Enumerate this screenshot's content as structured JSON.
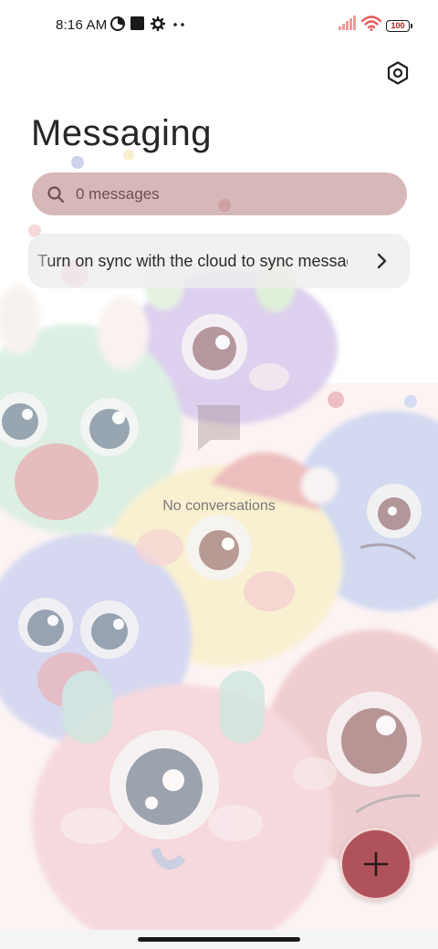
{
  "status_bar": {
    "time": "8:16 AM",
    "icons": [
      "pie-chart-icon",
      "square-icon",
      "gear-icon",
      "more-dots-icon"
    ],
    "signal": "signal-icon",
    "wifi": "wifi-icon",
    "battery_level": "100"
  },
  "header": {
    "title": "Messaging",
    "settings_icon": "settings-hexagon-icon"
  },
  "search": {
    "placeholder": "0 messages"
  },
  "sync_banner": {
    "text": "Turn on sync with the cloud to sync messages"
  },
  "empty_state": {
    "icon": "message-bubble-icon",
    "text": "No conversations"
  },
  "fab": {
    "icon": "plus-icon"
  },
  "colors": {
    "accent": "#b0525a",
    "search_bg": "#c9a2a2",
    "banner_bg": "#eeeeee"
  }
}
